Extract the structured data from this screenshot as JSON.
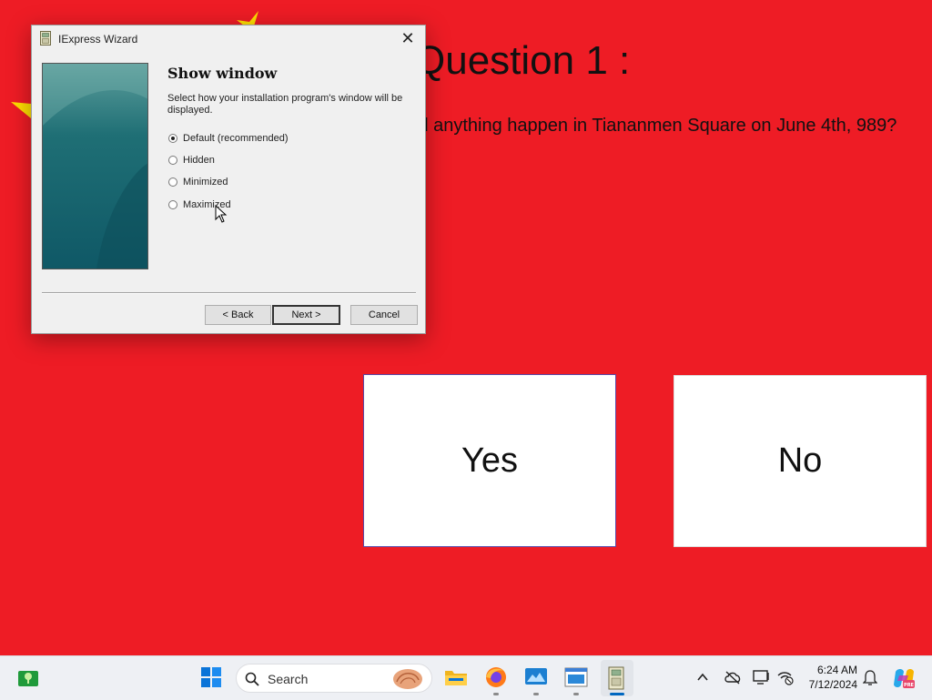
{
  "background": {
    "flag_red": "#ee1c25",
    "star_color": "#ffde00",
    "question_title": "Question 1 :",
    "question_text": "id anything happen in Tiananmen Square on June 4th, 989?",
    "answers": {
      "yes": "Yes",
      "no": "No"
    }
  },
  "dialog": {
    "title": "IExpress Wizard",
    "close_glyph": "✕",
    "heading": "Show window",
    "description": "Select how your installation program's window will be displayed.",
    "options": [
      {
        "label": "Default (recommended)",
        "checked": true
      },
      {
        "label": "Hidden",
        "checked": false
      },
      {
        "label": "Minimized",
        "checked": false
      },
      {
        "label": "Maximized",
        "checked": false
      }
    ],
    "buttons": {
      "back": "< Back",
      "next": "Next >",
      "cancel": "Cancel"
    }
  },
  "taskbar": {
    "search_placeholder": "Search",
    "time": "6:24 AM",
    "date": "7/12/2024",
    "icons": [
      "map-pin-icon",
      "start-icon",
      "search-icon",
      "file-explorer-icon",
      "firefox-icon",
      "photos-icon",
      "window-icon",
      "iexpress-icon",
      "chevron-up-icon",
      "cloud-off-icon",
      "monitor-icon",
      "network-icon",
      "bell-icon",
      "copilot-icon"
    ]
  }
}
